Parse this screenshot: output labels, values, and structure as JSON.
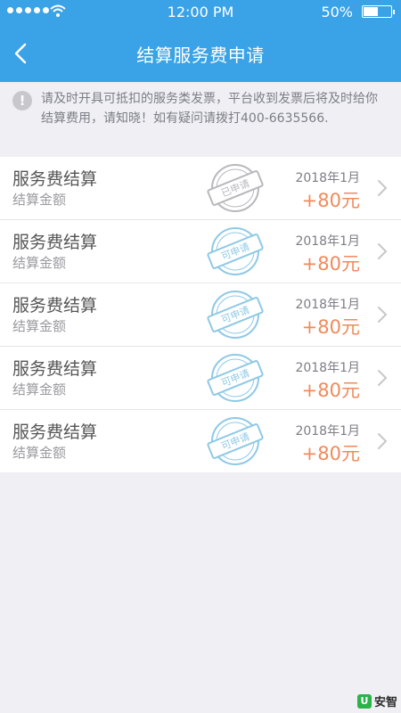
{
  "status_bar": {
    "time": "12:00 PM",
    "battery": "50%"
  },
  "header": {
    "title": "结算服务费申请"
  },
  "notice": {
    "text": "请及时开具可抵扣的服务类发票，平台收到发票后将及时给你结算费用，请知晓！如有疑问请拨打400-6635566."
  },
  "rows": [
    {
      "title": "服务费结算",
      "subtitle": "结算金额",
      "stamp": "已申请",
      "stamp_color": "#b8b8bd",
      "date": "2018年1月",
      "amount": "+80元"
    },
    {
      "title": "服务费结算",
      "subtitle": "结算金额",
      "stamp": "可申请",
      "stamp_color": "#8fc9e6",
      "date": "2018年1月",
      "amount": "+80元"
    },
    {
      "title": "服务费结算",
      "subtitle": "结算金额",
      "stamp": "可申请",
      "stamp_color": "#8fc9e6",
      "date": "2018年1月",
      "amount": "+80元"
    },
    {
      "title": "服务费结算",
      "subtitle": "结算金额",
      "stamp": "可申请",
      "stamp_color": "#8fc9e6",
      "date": "2018年1月",
      "amount": "+80元"
    },
    {
      "title": "服务费结算",
      "subtitle": "结算金额",
      "stamp": "可申请",
      "stamp_color": "#8fc9e6",
      "date": "2018年1月",
      "amount": "+80元"
    }
  ],
  "watermark": {
    "text": "安智"
  },
  "colors": {
    "header": "#3aa2e6",
    "amount": "#f08a5a",
    "background": "#efeff4"
  }
}
